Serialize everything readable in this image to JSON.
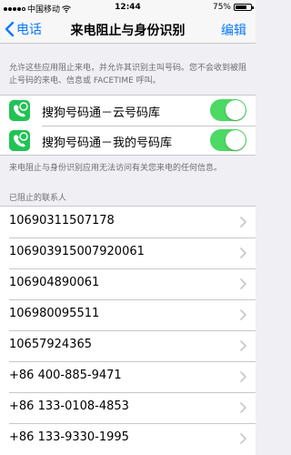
{
  "status_bar": {
    "carrier": "中国移动",
    "time": "12:44",
    "battery_percent": "75%",
    "battery_level": 0.75,
    "signal_icon": "signal-dots-icon",
    "wifi_icon": "wifi-icon",
    "battery_icon": "battery-icon"
  },
  "nav": {
    "back_label": "电话",
    "back_icon": "chevron-left-icon",
    "title": "来电阻止与身份识别",
    "edit_label": "编辑"
  },
  "top_description": "允许这些应用阻止来电，并允许其识别主叫号码。您不会收到被阻止号码的来电、信息或 FACETIME 呼叫。",
  "apps": [
    {
      "label": "搜狗号码通－云号码库",
      "icon": "sogou-app-icon",
      "enabled": true
    },
    {
      "label": "搜狗号码通－我的号码库",
      "icon": "sogou-app-icon",
      "enabled": true
    }
  ],
  "middle_description": "来电阻止与身份识别应用无法访问有关您来电的任何信息。",
  "blocked_header": "已阻止的联系人",
  "blocked_contacts": [
    "10690311507178",
    "106903915007920061",
    "106904890061",
    "106980095511",
    "10657924365",
    "+86 400-885-9471",
    "+86 133-0108-4853",
    "+86 133-9330-1995"
  ],
  "colors": {
    "accent": "#0a7aff",
    "toggle_on": "#4cd964",
    "app_icon": "#21c355",
    "background": "#efeff4"
  }
}
